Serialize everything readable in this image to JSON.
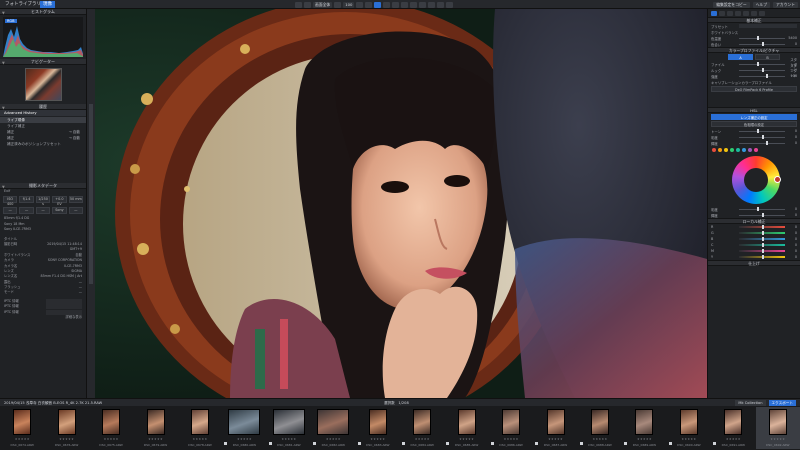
{
  "tabs": [
    {
      "label": "フォトライブラリ",
      "active": false
    },
    {
      "label": "現像",
      "active": true
    }
  ],
  "toolbar": {
    "zoom_label": "100",
    "fit_label": "画面全体",
    "right_buttons": [
      "編集設定をコピー",
      "ヘルプ",
      "アカウント"
    ]
  },
  "left_panel": {
    "histogram_title": "ヒストグラム",
    "histogram_tag": "RGB",
    "navigator_title": "ナビゲーター",
    "versions_title": "履歴",
    "versions_section": "Advanced History",
    "versions": [
      "ライブ現像",
      "ライブ補正",
      "補正",
      "補正",
      "補正済みのポジションプリセット"
    ],
    "versions_values": [
      "",
      "",
      "→ 自動",
      "→ 自動",
      ""
    ],
    "metadata_title": "撮影メタデータ",
    "exif_header": "Exif",
    "exif_buttons": [
      "ISO 400",
      "f/1.4",
      "1/250 s",
      "+0.0 EV",
      "50 mm"
    ],
    "mode_buttons": [
      "—",
      "—",
      "—",
      "Sony",
      "—"
    ],
    "lens_lines": [
      "85mm f/1.4 DG",
      "Sony 18 Mm",
      "Sony ILCE-7RM3"
    ],
    "info_rows": [
      {
        "k": "タイトル",
        "v": ""
      },
      {
        "k": "撮影日時",
        "v": "2019/04/15 11:48:14"
      },
      {
        "k": "",
        "v": "GMT+9"
      },
      {
        "k": "ホワイトバランス",
        "v": "自動"
      },
      {
        "k": "カメラ",
        "v": "SONY CORPORATION"
      },
      {
        "k": "カメラ名",
        "v": "ILCE-7RM3"
      },
      {
        "k": "レンズ",
        "v": "SIGMA"
      },
      {
        "k": "レンズ名",
        "v": "85mm F1.4 DG HSM | Art"
      },
      {
        "k": "露出",
        "v": "—"
      },
      {
        "k": "フラッシュ",
        "v": "—"
      },
      {
        "k": "モード",
        "v": "—"
      }
    ],
    "iptc_rows": [
      "IPTC 情報",
      "IPTC 情報",
      "IPTC 情報"
    ],
    "footer": "詳細な表示"
  },
  "right_panel": {
    "basic_title": "基本補正",
    "presets_label": "プリセット",
    "wb_section": "ホワイトバランス",
    "wb_rows": [
      {
        "label": "色温度",
        "value": "5400"
      },
      {
        "label": "色合い",
        "value": "0"
      }
    ],
    "tone_section": "カラープロファイル/ピクチャ",
    "tone_buttons": [
      "A",
      "B"
    ],
    "tone_rows": [
      {
        "label": "ファイル",
        "value": "スタンダード"
      },
      {
        "label": "ルック",
        "value": "スタンダード"
      },
      {
        "label": "強度",
        "value": "100"
      }
    ],
    "profile_label": "キャリブレーションカラープロファイル",
    "profile_value": "DxO FilmPack 6 Profile",
    "hsl_title": "HSL",
    "hsl_buttons": [
      "レンズ補正の設定",
      "色相環の設定"
    ],
    "hsl_rows": [
      {
        "label": "トーン",
        "value": "0"
      },
      {
        "label": "彩度",
        "value": "0"
      },
      {
        "label": "輝度",
        "value": "0"
      }
    ],
    "color_dots": [
      "#e74c3c",
      "#f39c12",
      "#f1c40f",
      "#2ecc71",
      "#1abc9c",
      "#3498db",
      "#9b59b6",
      "#e84393"
    ],
    "wheel_rows": [
      {
        "label": "彩度",
        "value": "0"
      },
      {
        "label": "輝度",
        "value": "0"
      }
    ],
    "local_title": "ローカル補正",
    "rgb_rows": [
      {
        "label": "R",
        "value": "0"
      },
      {
        "label": "G",
        "value": "0"
      },
      {
        "label": "B",
        "value": "0"
      },
      {
        "label": "C",
        "value": "0"
      },
      {
        "label": "M",
        "value": "0"
      },
      {
        "label": "Y",
        "value": "0"
      }
    ],
    "bottom_title": "仕上げ"
  },
  "filmstrip": {
    "path": "2019/04/15 浅草寺 白衣観音 B-EOS R_4K 2.7K 21.5.RAW",
    "count": "選択数",
    "count_value": "1/208",
    "buttons": [
      "Mk Collection",
      "エクスポート"
    ],
    "items": [
      {
        "name": "DSC_0674.ARW",
        "colors": [
          "#5a2c1c",
          "#c9835c"
        ],
        "sel": false,
        "flag": false
      },
      {
        "name": "DSC_0676.ARW",
        "colors": [
          "#6a3a25",
          "#d3a07c"
        ],
        "sel": false,
        "flag": false
      },
      {
        "name": "DSC_0675.ARW",
        "colors": [
          "#4a2d22",
          "#b67a5b"
        ],
        "sel": false,
        "flag": false
      },
      {
        "name": "DSC_0679.ARW",
        "colors": [
          "#3b2a24",
          "#c59070"
        ],
        "sel": false,
        "flag": false
      },
      {
        "name": "DSC_0678.ARW",
        "colors": [
          "#614035",
          "#d6a88a"
        ],
        "sel": false,
        "flag": false
      },
      {
        "name": "DSC_0680.ARW",
        "colors": [
          "#2f3b44",
          "#7b8b99"
        ],
        "sel": false,
        "flag": true
      },
      {
        "name": "DSC_0681.ARW",
        "colors": [
          "#2a2f36",
          "#8f8f93"
        ],
        "sel": false,
        "flag": true
      },
      {
        "name": "DSC_0682.ARW",
        "colors": [
          "#3d3535",
          "#9a6e5d"
        ],
        "sel": false,
        "flag": true
      },
      {
        "name": "DSC_0683.ARW",
        "colors": [
          "#4b2e22",
          "#c38a66"
        ],
        "sel": false,
        "flag": true
      },
      {
        "name": "DSC_0684.ARW",
        "colors": [
          "#3c2b25",
          "#bf8f72"
        ],
        "sel": false,
        "flag": true
      },
      {
        "name": "DSC_0685.ARW",
        "colors": [
          "#5b3a2d",
          "#d0a387"
        ],
        "sel": false,
        "flag": true
      },
      {
        "name": "DSC_0686.ARW",
        "colors": [
          "#4d3a33",
          "#b9907a"
        ],
        "sel": false,
        "flag": true
      },
      {
        "name": "DSC_0687.ARW",
        "colors": [
          "#54372b",
          "#c6967a"
        ],
        "sel": false,
        "flag": true
      },
      {
        "name": "DSC_0688.ARW",
        "colors": [
          "#392824",
          "#b78a70"
        ],
        "sel": false,
        "flag": true
      },
      {
        "name": "DSC_0689.ARW",
        "colors": [
          "#4a3a34",
          "#a8897c"
        ],
        "sel": false,
        "flag": true
      },
      {
        "name": "DSC_0690.ARW",
        "colors": [
          "#5d3b2c",
          "#c9987a"
        ],
        "sel": false,
        "flag": true
      },
      {
        "name": "DSC_0691.ARW",
        "colors": [
          "#4a3029",
          "#d0a48a"
        ],
        "sel": false,
        "flag": true
      },
      {
        "name": "DSC_0692.ARW",
        "colors": [
          "#5f4439",
          "#dbb39b"
        ],
        "sel": true,
        "flag": false
      }
    ]
  }
}
